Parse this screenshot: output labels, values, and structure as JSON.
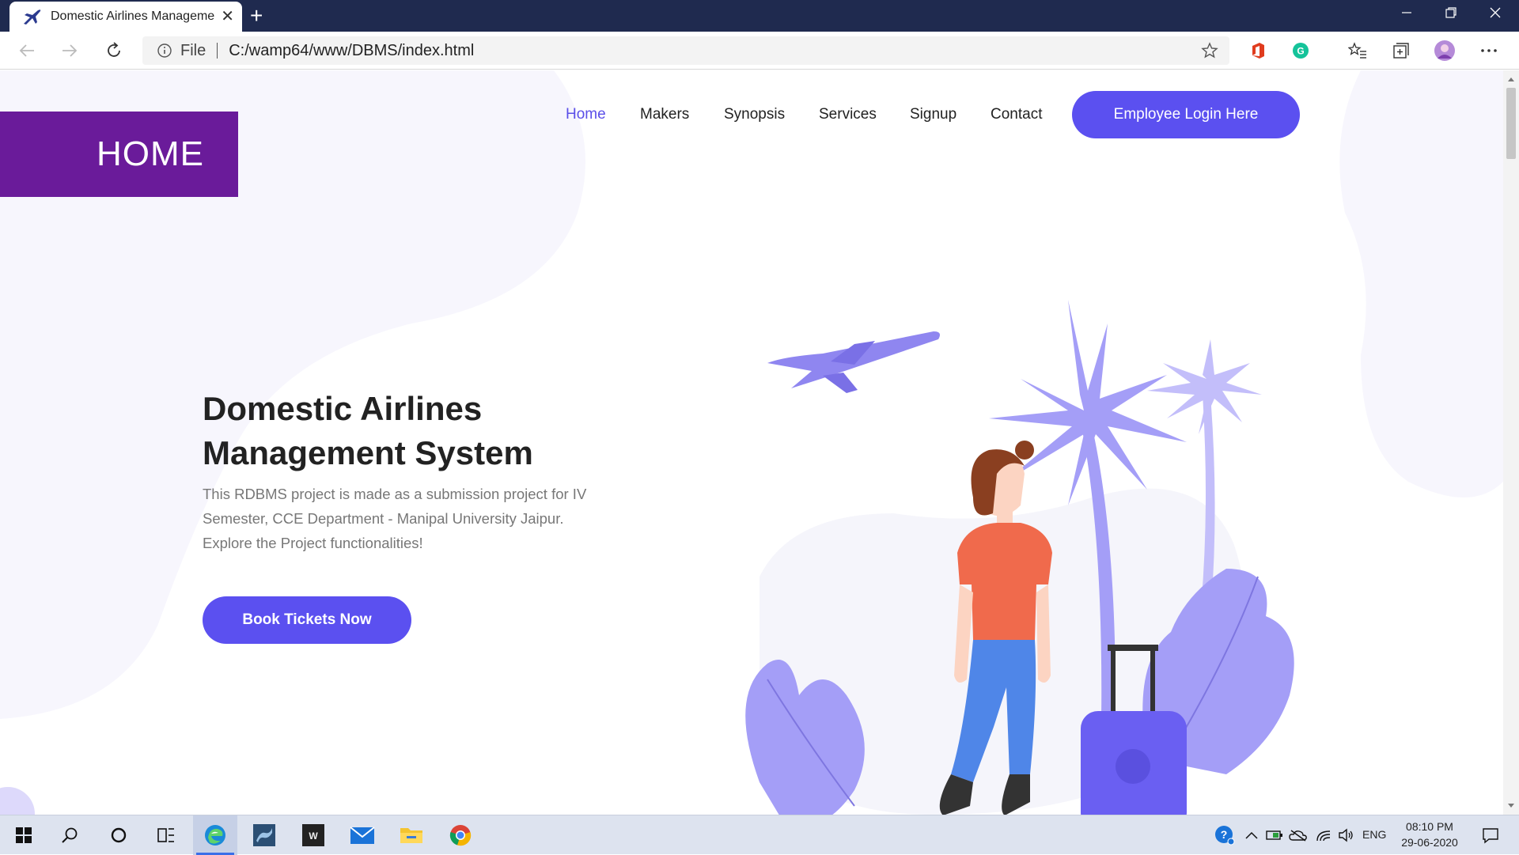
{
  "browser": {
    "tab_title": "Domestic Airlines Management S",
    "new_tab_glyph": "+",
    "address_scheme_label": "File",
    "address_url": "C:/wamp64/www/DBMS/index.html"
  },
  "page": {
    "home_badge": "HOME",
    "nav": {
      "items": [
        {
          "label": "Home",
          "active": true
        },
        {
          "label": "Makers",
          "active": false
        },
        {
          "label": "Synopsis",
          "active": false
        },
        {
          "label": "Services",
          "active": false
        },
        {
          "label": "Signup",
          "active": false
        },
        {
          "label": "Contact",
          "active": false
        }
      ],
      "login_button": "Employee Login Here"
    },
    "hero": {
      "title_line1": "Domestic Airlines",
      "title_line2": "Management System",
      "description": "This RDBMS project is made as a submission project for IV Semester, CCE Department - Manipal University Jaipur. Explore the Project functionalities!",
      "cta_button": "Book Tickets Now"
    }
  },
  "taskbar": {
    "apps": [
      "windows-start-icon",
      "search-icon",
      "cortana-icon",
      "task-view-icon",
      "edge-icon",
      "mysql-workbench-icon",
      "wamp-icon",
      "mail-icon",
      "file-explorer-icon",
      "chrome-icon"
    ],
    "language": "ENG",
    "time": "08:10 PM",
    "date": "29-06-2020"
  },
  "colors": {
    "accent": "#5b50f0",
    "home_badge": "#6a1b9a",
    "titlebar": "#1f2a4f",
    "illustration_purple": "#9b94f7"
  }
}
